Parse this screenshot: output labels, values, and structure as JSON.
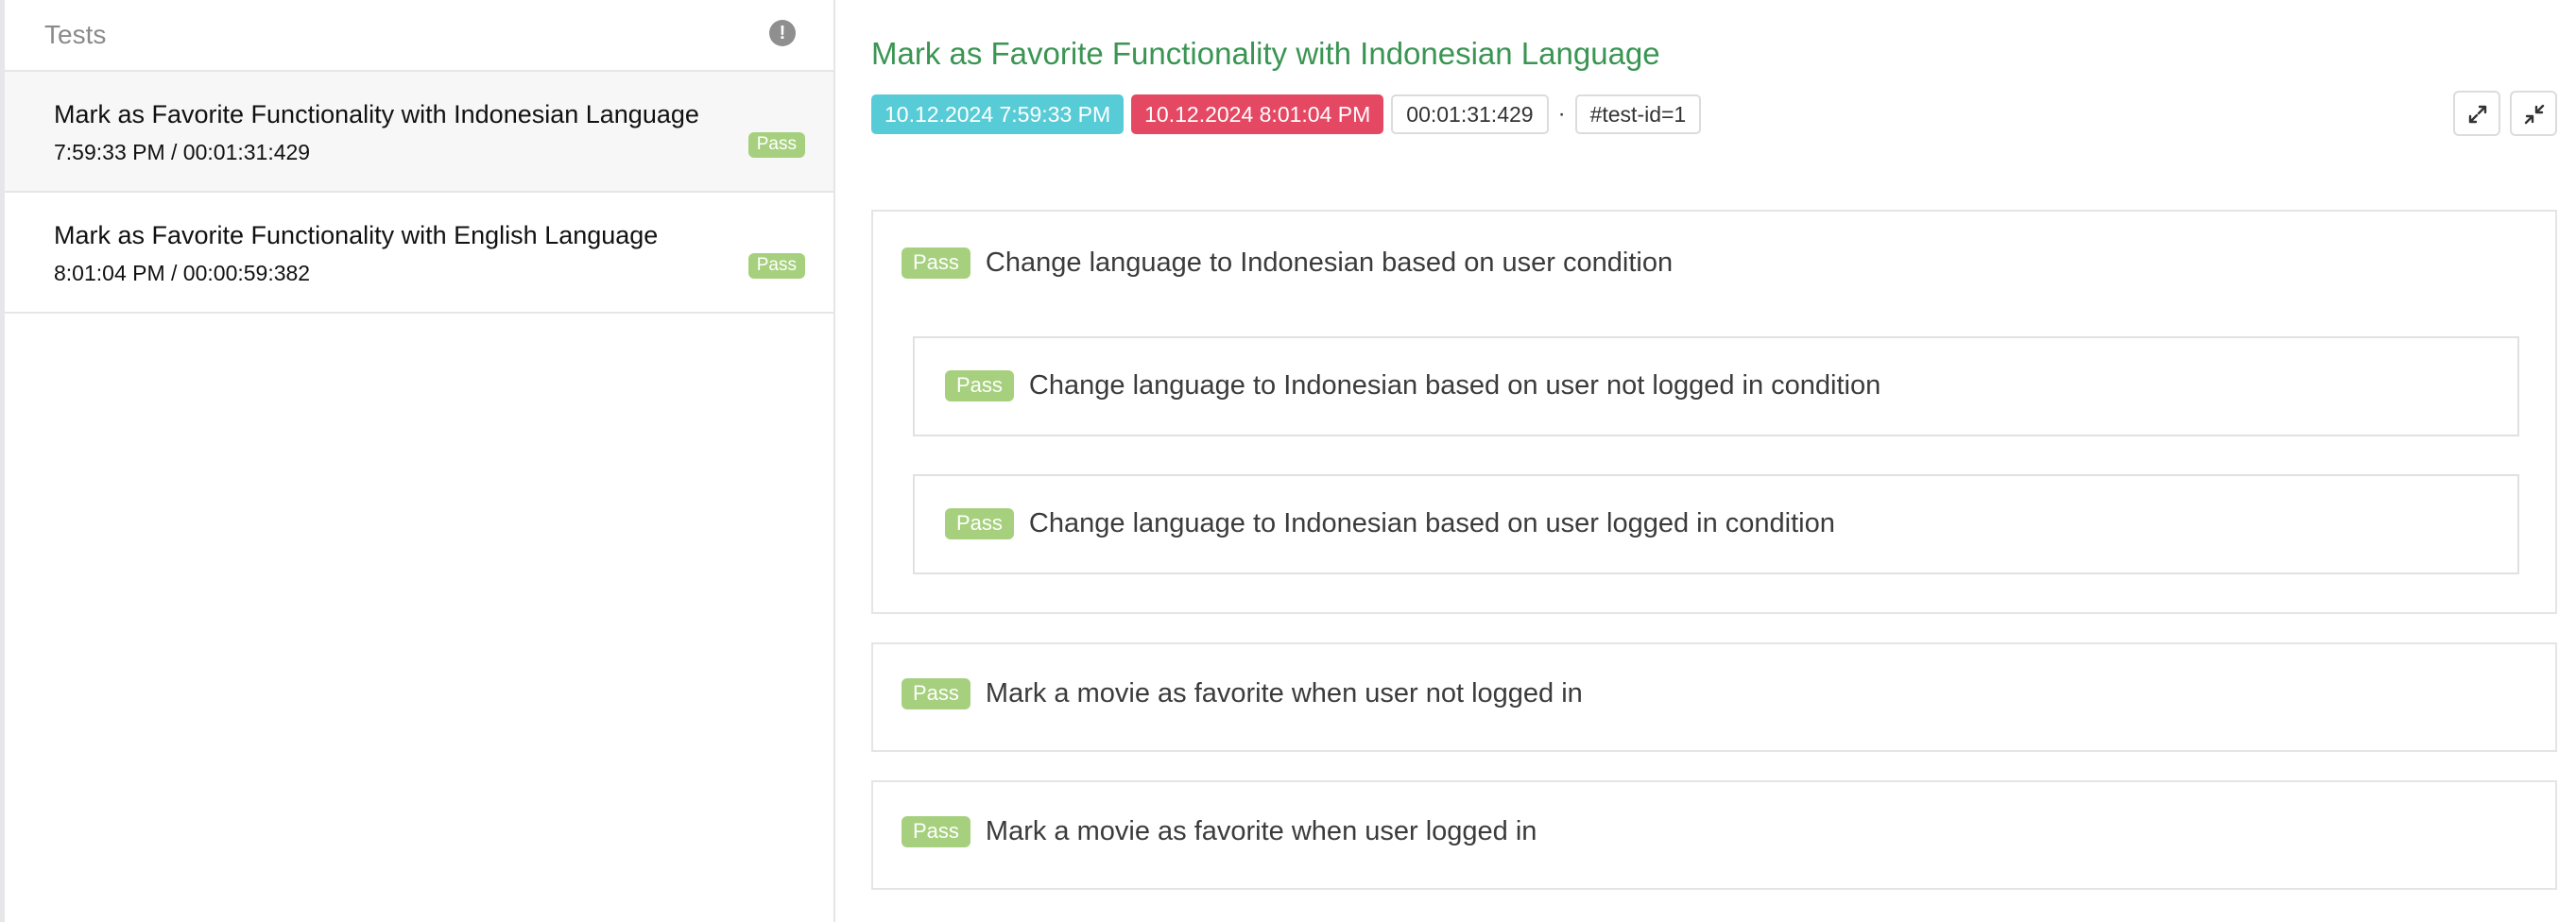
{
  "sidebar": {
    "header_title": "Tests",
    "alert_glyph": "!",
    "tests": [
      {
        "name": "Mark as Favorite Functionality with Indonesian Language",
        "meta": "7:59:33 PM / 00:01:31:429",
        "status": "Pass"
      },
      {
        "name": "Mark as Favorite Functionality with English Language",
        "meta": "8:01:04 PM / 00:00:59:382",
        "status": "Pass"
      }
    ]
  },
  "detail": {
    "title": "Mark as Favorite Functionality with Indonesian Language",
    "start_time": "10.12.2024 7:59:33 PM",
    "end_time": "10.12.2024 8:01:04 PM",
    "duration": "00:01:31:429",
    "separator": "·",
    "test_id": "#test-id=1",
    "expand_icon": "expand-icon",
    "collapse_icon": "collapse-icon",
    "nodes": [
      {
        "status": "Pass",
        "label": "Change language to Indonesian based on user condition",
        "children": [
          {
            "status": "Pass",
            "label": "Change language to Indonesian based on user not logged in condition"
          },
          {
            "status": "Pass",
            "label": "Change language to Indonesian based on user logged in condition"
          }
        ]
      },
      {
        "status": "Pass",
        "label": "Mark a movie as favorite when user not logged in"
      },
      {
        "status": "Pass",
        "label": "Mark a movie as favorite when user logged in"
      }
    ]
  },
  "colors": {
    "pass": "#a6d07e",
    "title_green": "#3a9553",
    "start_pill": "#58ccd6",
    "end_pill": "#e54863"
  }
}
